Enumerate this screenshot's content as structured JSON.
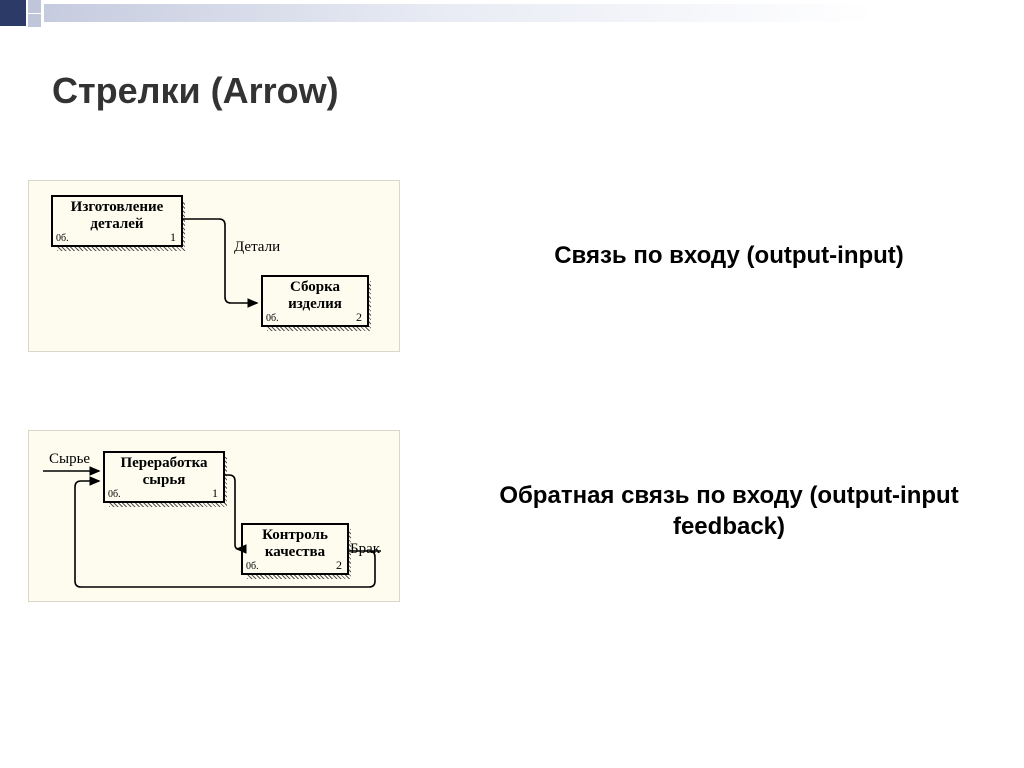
{
  "title": "Стрелки (Arrow)",
  "diagramA": {
    "caption": "Связь по входу (output-input)",
    "box1": {
      "label": "Изготовление деталей",
      "bl": "0б.",
      "br": "1"
    },
    "box2": {
      "label": "Сборка изделия",
      "bl": "0б.",
      "br": "2"
    },
    "arrowLabel": "Детали"
  },
  "diagramB": {
    "caption": "Обратная связь по входу (output-input feedback)",
    "box1": {
      "label": "Переработка сырья",
      "bl": "0б.",
      "br": "1"
    },
    "box2": {
      "label": "Контроль качества",
      "bl": "0б.",
      "br": "2"
    },
    "inputLabel": "Сырье",
    "outputLabel": "Брак"
  }
}
